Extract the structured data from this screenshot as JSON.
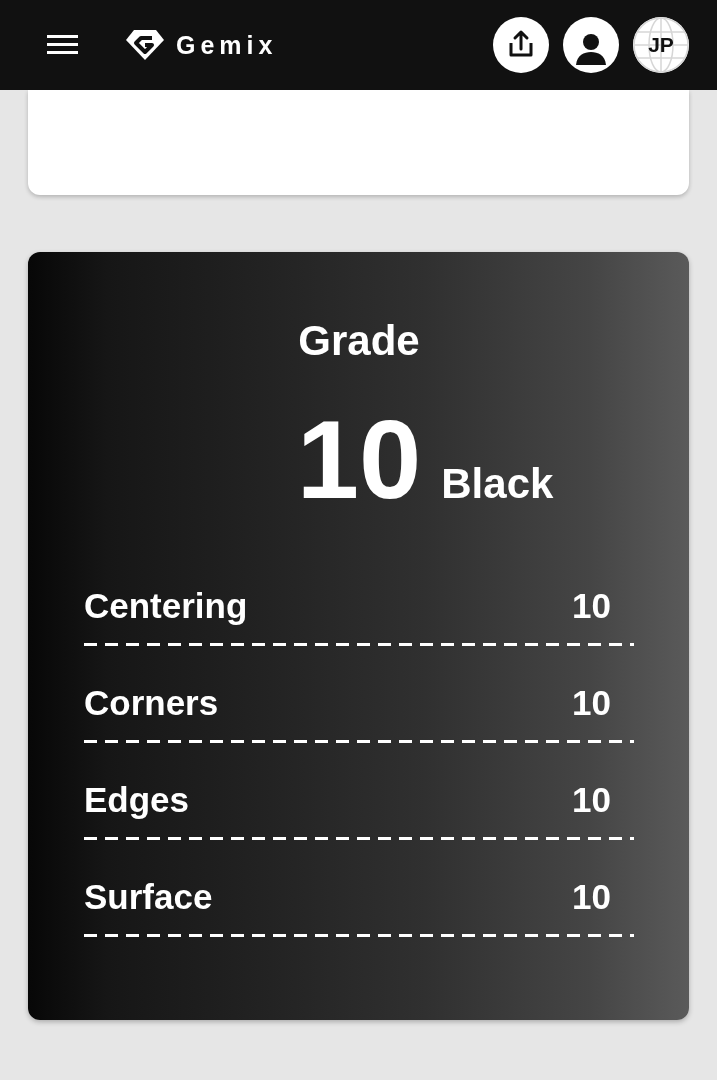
{
  "header": {
    "logo_text": "Gemix",
    "buttons": [
      {
        "kind": "share"
      },
      {
        "kind": "profile"
      },
      {
        "kind": "language",
        "label": "JP"
      }
    ]
  },
  "grade_card": {
    "title": "Grade",
    "score": "10",
    "score_label": "Black",
    "subgrades": [
      {
        "name": "Centering",
        "value": "10"
      },
      {
        "name": "Corners",
        "value": "10"
      },
      {
        "name": "Edges",
        "value": "10"
      },
      {
        "name": "Surface",
        "value": "10"
      }
    ]
  }
}
